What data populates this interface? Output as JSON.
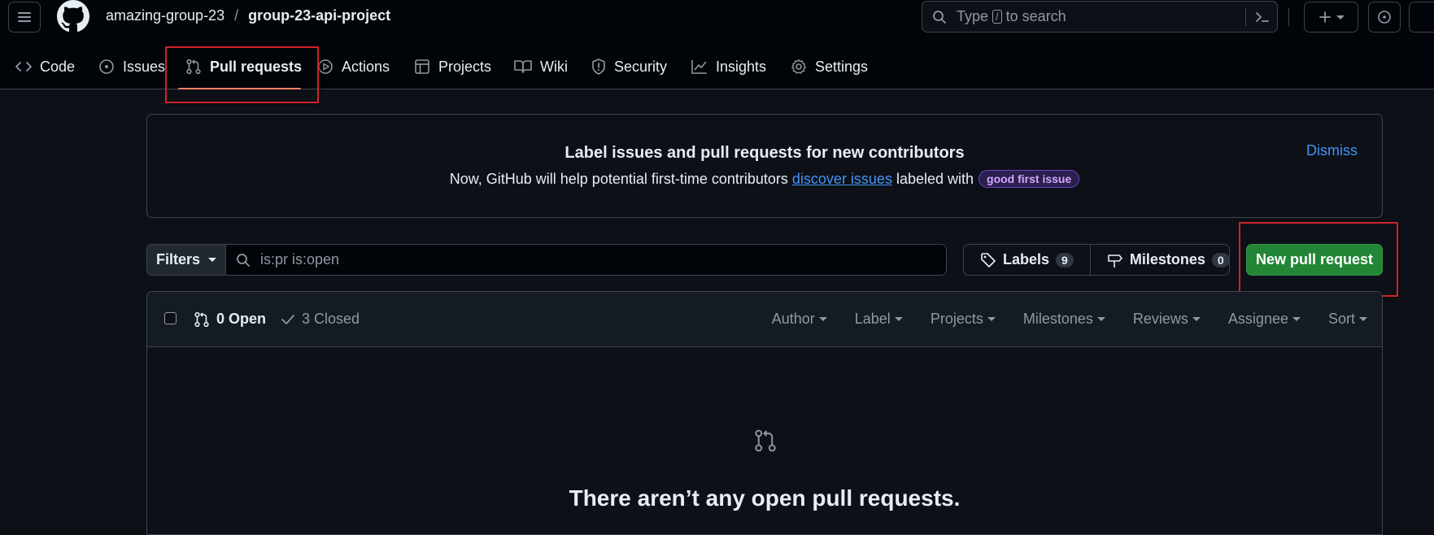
{
  "header": {
    "owner": "amazing-group-23",
    "separator": "/",
    "repo": "group-23-api-project",
    "search": {
      "prefix": "Type",
      "key": "/",
      "suffix": "to search"
    }
  },
  "nav": {
    "tabs": [
      {
        "label": "Code",
        "icon": "code-icon"
      },
      {
        "label": "Issues",
        "icon": "issue-opened-icon"
      },
      {
        "label": "Pull requests",
        "icon": "git-pull-request-icon",
        "selected": true
      },
      {
        "label": "Actions",
        "icon": "play-icon"
      },
      {
        "label": "Projects",
        "icon": "table-icon"
      },
      {
        "label": "Wiki",
        "icon": "book-icon"
      },
      {
        "label": "Security",
        "icon": "shield-icon"
      },
      {
        "label": "Insights",
        "icon": "graph-icon"
      },
      {
        "label": "Settings",
        "icon": "gear-icon"
      }
    ]
  },
  "banner": {
    "title": "Label issues and pull requests for new contributors",
    "text_before": "Now, GitHub will help potential first-time contributors",
    "link": "discover issues",
    "text_after": "labeled with",
    "label": "good first issue",
    "dismiss": "Dismiss"
  },
  "toolbar": {
    "filters": "Filters",
    "query": "is:pr is:open",
    "labels": "Labels",
    "labels_count": "9",
    "milestones": "Milestones",
    "milestones_count": "0",
    "new_pr": "New pull request"
  },
  "list": {
    "open": "0 Open",
    "closed": "3 Closed",
    "sorters": [
      "Author",
      "Label",
      "Projects",
      "Milestones",
      "Reviews",
      "Assignee",
      "Sort"
    ],
    "empty_title": "There aren’t any open pull requests."
  },
  "colors": {
    "accent_link": "#4493f8",
    "primary_button": "#238636",
    "tab_underline": "#f78166",
    "annotation_box": "#d0232a"
  }
}
